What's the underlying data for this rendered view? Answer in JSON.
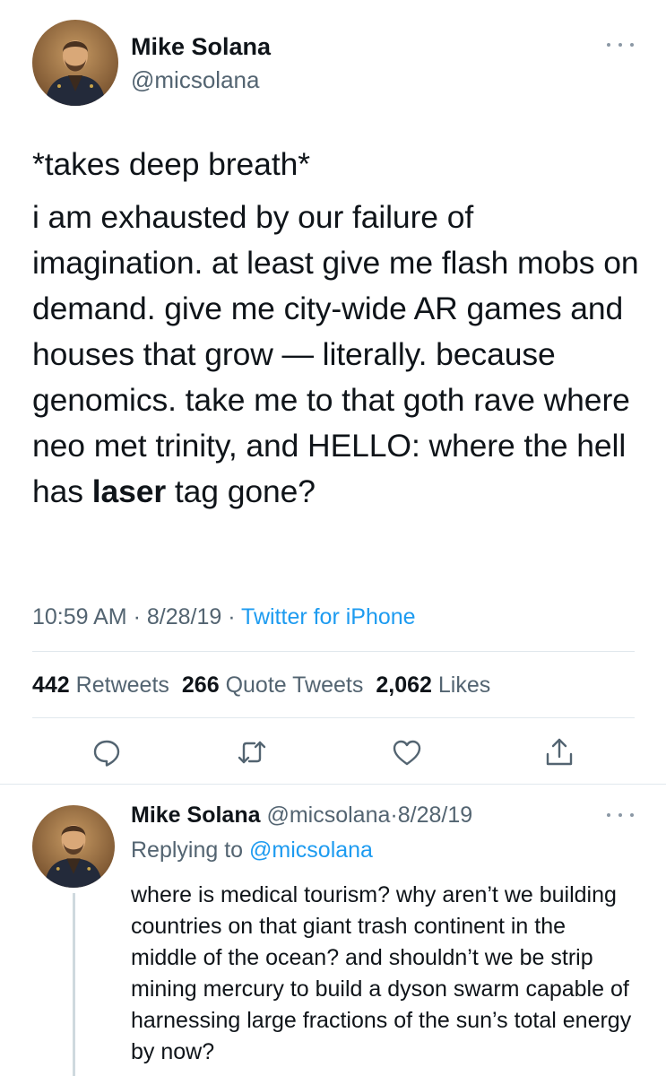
{
  "tweet": {
    "author": {
      "name": "Mike Solana",
      "handle": "@micsolana",
      "avatar": "portrait-avatar"
    },
    "more_icon": "ellipsis-icon",
    "text": {
      "line1": "*takes deep breath*",
      "para_before_bold": "i am exhausted by our failure of imagination. at least give me flash mobs on demand. give me city-wide AR games and houses that grow — literally. because genomics. take me to that goth rave where neo met trinity, and HELLO: where the hell has ",
      "bold_word": "laser",
      "para_after_bold": " tag gone?"
    },
    "meta": {
      "time": "10:59 AM",
      "sep1": " · ",
      "date": "8/28/19",
      "sep2": " · ",
      "source": "Twitter for iPhone"
    },
    "stats": {
      "retweets_count": "442",
      "retweets_label": "Retweets",
      "quote_count": "266",
      "quote_label": "Quote Tweets",
      "likes_count": "2,062",
      "likes_label": "Likes"
    },
    "actions": [
      "reply-icon",
      "retweet-icon",
      "like-icon",
      "share-icon"
    ]
  },
  "reply": {
    "author_name": "Mike Solana",
    "author_handle": "@micsolana",
    "dot": "·",
    "date": "8/28/19",
    "replying_prefix": "Replying to ",
    "replying_to": "@micsolana",
    "text": "where is medical tourism? why aren’t we building countries on that giant trash continent in the middle of the ocean? and shouldn’t we be strip mining mercury to build a dyson swarm capable of harnessing large fractions of the sun’s total energy by now?"
  },
  "colors": {
    "link_blue": "#1d9bf0",
    "secondary_text": "#536471",
    "primary_text": "#0f1419",
    "divider": "#e1e8ed"
  }
}
